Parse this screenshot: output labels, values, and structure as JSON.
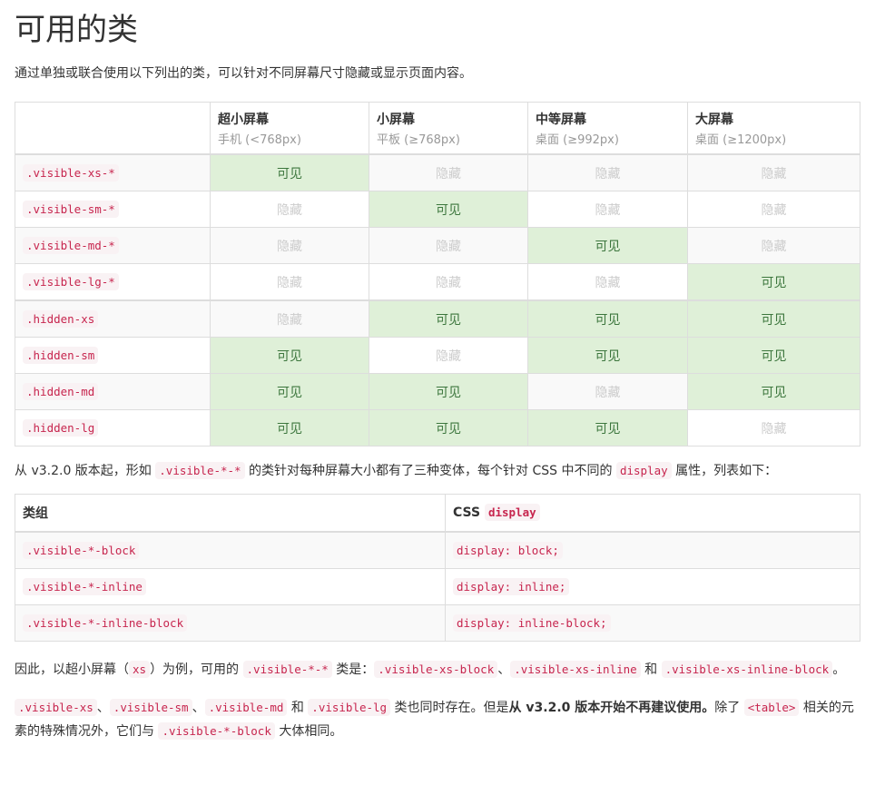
{
  "title": "可用的类",
  "lead": "通过单独或联合使用以下列出的类，可以针对不同屏幕尺寸隐藏或显示页面内容。",
  "table1": {
    "headers": [
      {
        "title": "超小屏幕",
        "sub": "手机 (<768px)"
      },
      {
        "title": "小屏幕",
        "sub": "平板 (≥768px)"
      },
      {
        "title": "中等屏幕",
        "sub": "桌面 (≥992px)"
      },
      {
        "title": "大屏幕",
        "sub": "桌面 (≥1200px)"
      }
    ],
    "visible_label": "可见",
    "hidden_label": "隐藏",
    "rows": [
      {
        "cls": ".visible-xs-*",
        "cells": [
          "v",
          "h",
          "h",
          "h"
        ]
      },
      {
        "cls": ".visible-sm-*",
        "cells": [
          "h",
          "v",
          "h",
          "h"
        ]
      },
      {
        "cls": ".visible-md-*",
        "cells": [
          "h",
          "h",
          "v",
          "h"
        ]
      },
      {
        "cls": ".visible-lg-*",
        "cells": [
          "h",
          "h",
          "h",
          "v"
        ]
      },
      {
        "cls": ".hidden-xs",
        "cells": [
          "h",
          "v",
          "v",
          "v"
        ]
      },
      {
        "cls": ".hidden-sm",
        "cells": [
          "v",
          "h",
          "v",
          "v"
        ]
      },
      {
        "cls": ".hidden-md",
        "cells": [
          "v",
          "v",
          "h",
          "v"
        ]
      },
      {
        "cls": ".hidden-lg",
        "cells": [
          "v",
          "v",
          "v",
          "h"
        ]
      }
    ]
  },
  "p2": [
    {
      "t": "从 v3.2.0 版本起，形如 "
    },
    {
      "c": ".visible-*-*"
    },
    {
      "t": " 的类针对每种屏幕大小都有了三种变体，每个针对 CSS 中不同的 "
    },
    {
      "c": "display"
    },
    {
      "t": " 属性，列表如下："
    }
  ],
  "table2": {
    "h1": "类组",
    "h2": "CSS ",
    "h2code": "display",
    "rows": [
      {
        "a": ".visible-*-block",
        "b": "display: block;"
      },
      {
        "a": ".visible-*-inline",
        "b": "display: inline;"
      },
      {
        "a": ".visible-*-inline-block",
        "b": "display: inline-block;"
      }
    ]
  },
  "p3": [
    {
      "t": "因此，以超小屏幕（"
    },
    {
      "c": "xs"
    },
    {
      "t": "）为例，可用的 "
    },
    {
      "c": ".visible-*-*"
    },
    {
      "t": " 类是："
    },
    {
      "c": ".visible-xs-block"
    },
    {
      "t": "、"
    },
    {
      "c": ".visible-xs-inline"
    },
    {
      "t": " 和 "
    },
    {
      "c": ".visible-xs-inline-block"
    },
    {
      "t": "。"
    }
  ],
  "p4": [
    {
      "c": ".visible-xs"
    },
    {
      "t": "、"
    },
    {
      "c": ".visible-sm"
    },
    {
      "t": "、"
    },
    {
      "c": ".visible-md"
    },
    {
      "t": " 和 "
    },
    {
      "c": ".visible-lg"
    },
    {
      "t": " 类也同时存在。但是"
    },
    {
      "b": "从 v3.2.0 版本开始不再建议使用。"
    },
    {
      "t": "除了 "
    },
    {
      "c": "<table>"
    },
    {
      "t": " 相关的元素的特殊情况外，它们与 "
    },
    {
      "c": ".visible-*-block"
    },
    {
      "t": " 大体相同。"
    }
  ]
}
